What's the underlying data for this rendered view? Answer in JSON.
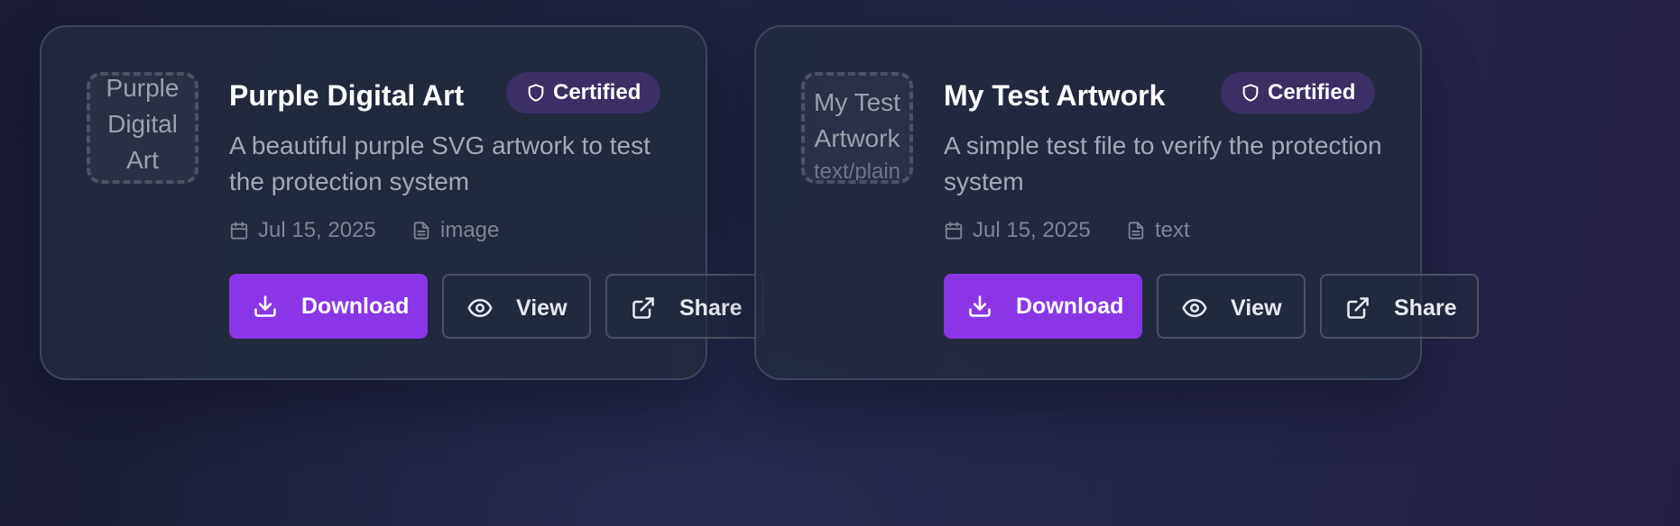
{
  "colors": {
    "accent": "#8a35e6",
    "badge_bg": "#3b2f66",
    "card_bg": "#222a3e"
  },
  "cards": [
    {
      "thumbnail": {
        "title": "Purple Digital Art",
        "subtitle": ""
      },
      "title": "Purple Digital Art",
      "badge": {
        "icon": "shield-icon",
        "label": "Certified"
      },
      "description": "A beautiful purple SVG artwork to test the protection system",
      "date": {
        "icon": "calendar-icon",
        "label": "Jul 15, 2025"
      },
      "type": {
        "icon": "file-icon",
        "label": "image"
      },
      "actions": {
        "download": {
          "icon": "download-icon",
          "label": "Download"
        },
        "view": {
          "icon": "eye-icon",
          "label": "View"
        },
        "share": {
          "icon": "external-link-icon",
          "label": "Share"
        }
      }
    },
    {
      "thumbnail": {
        "title": "My Test Artwork",
        "subtitle": "text/plain"
      },
      "title": "My Test Artwork",
      "badge": {
        "icon": "shield-icon",
        "label": "Certified"
      },
      "description": "A simple test file to verify the protection system",
      "date": {
        "icon": "calendar-icon",
        "label": "Jul 15, 2025"
      },
      "type": {
        "icon": "file-icon",
        "label": "text"
      },
      "actions": {
        "download": {
          "icon": "download-icon",
          "label": "Download"
        },
        "view": {
          "icon": "eye-icon",
          "label": "View"
        },
        "share": {
          "icon": "external-link-icon",
          "label": "Share"
        }
      }
    }
  ]
}
